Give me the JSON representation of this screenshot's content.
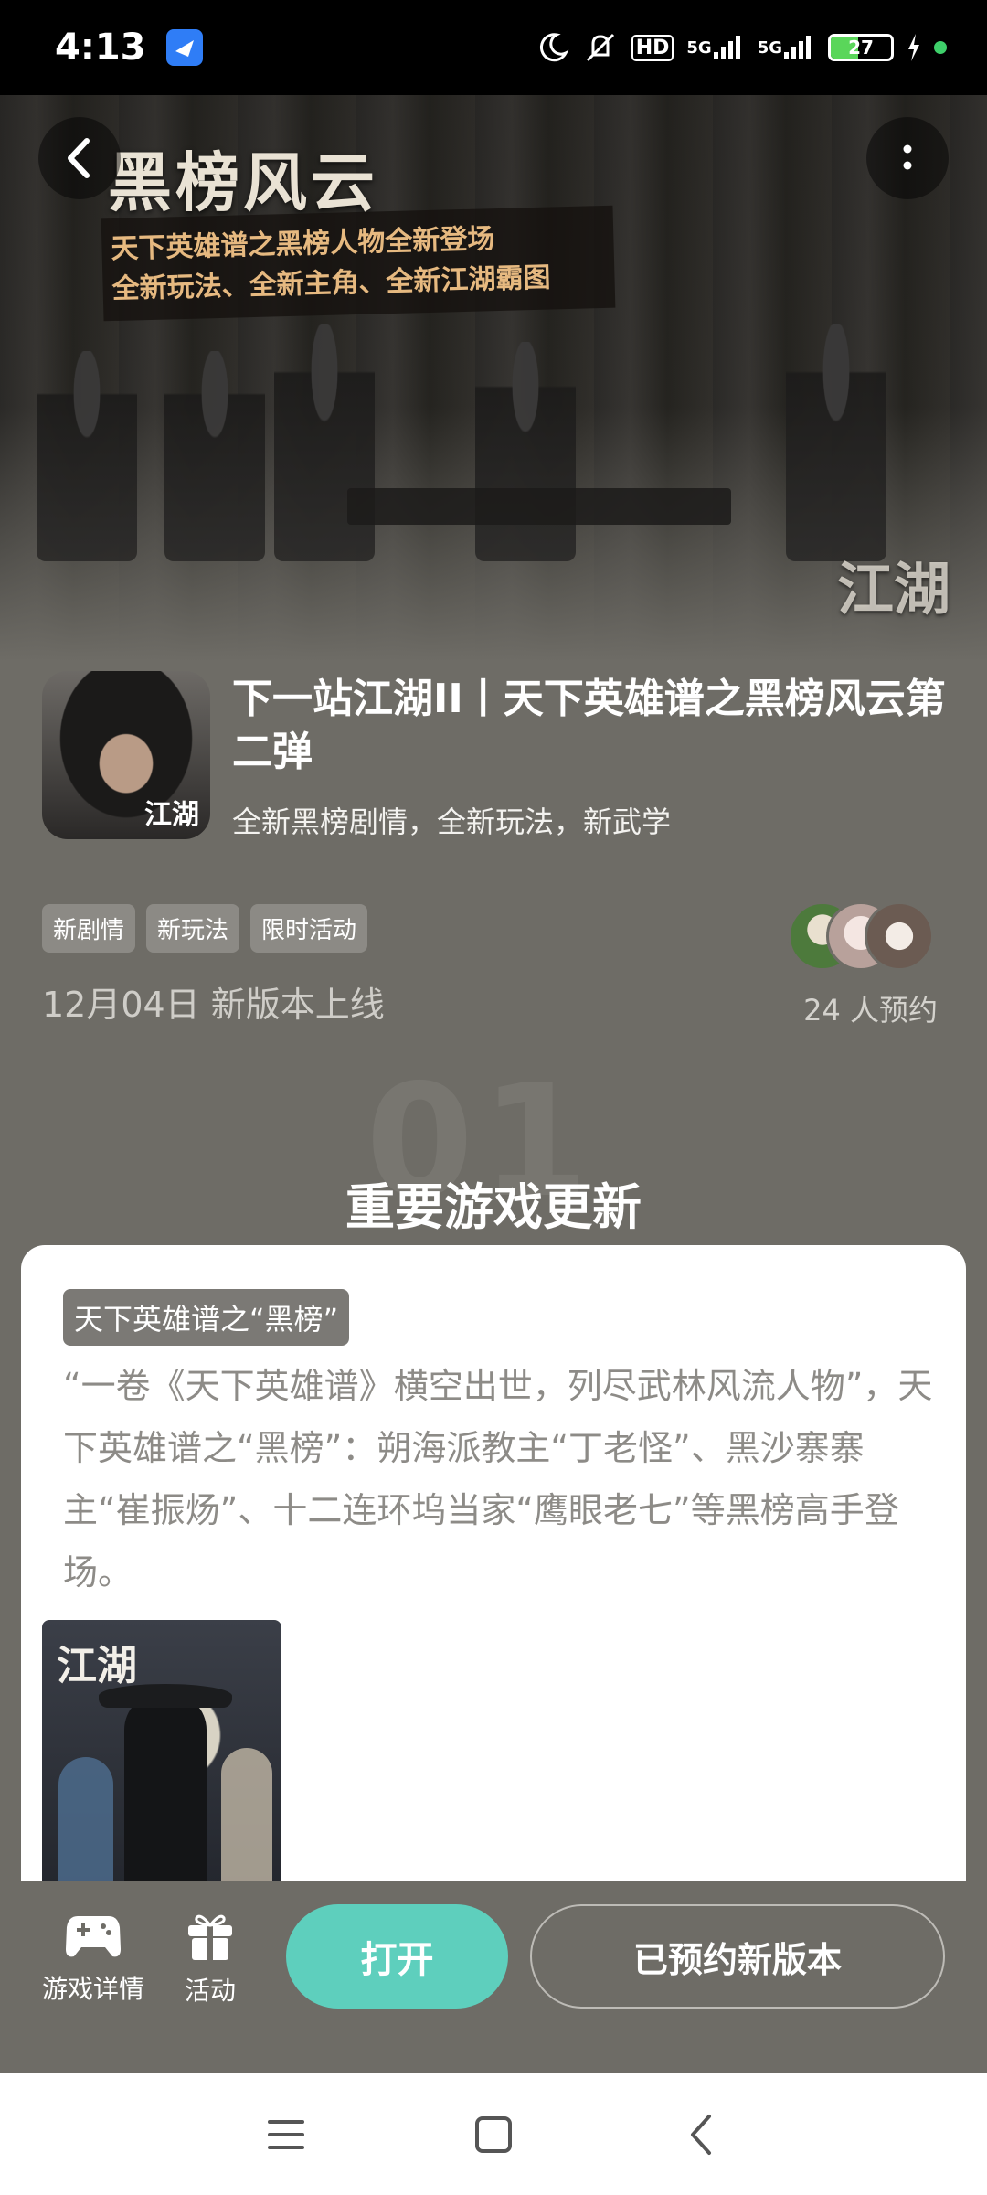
{
  "status_bar": {
    "time": "4:13",
    "battery": "27",
    "network_1": "5G",
    "network_2": "5G",
    "hd": "HD"
  },
  "banner": {
    "title": "黑榜风云",
    "subtitle_line1": "天下英雄谱之黑榜人物全新登场",
    "subtitle_line2": "全新玩法、全新主角、全新江湖霸图",
    "logo": "江湖"
  },
  "app": {
    "title": "下一站江湖II丨天下英雄谱之黑榜风云第二弹",
    "subtitle": "全新黑榜剧情，全新玩法，新武学",
    "icon_logo": "江湖",
    "tags": [
      "新剧情",
      "新玩法",
      "限时活动"
    ],
    "release": "12月04日 新版本上线",
    "reserve_count": "24 人预约"
  },
  "section": {
    "watermark": "01",
    "title": "重要游戏更新"
  },
  "card": {
    "tag": "天下英雄谱之“黑榜”",
    "text": "“一卷《天下英雄谱》横空出世，列尽武林风流人物”，天下英雄谱之“黑榜”：朔海派教主“丁老怪”、黑沙寨寨主“崔振炀”、十二连环坞当家“鹰眼老七”等黑榜高手登场。",
    "image_logo": "江湖"
  },
  "action_bar": {
    "tab_details": "游戏详情",
    "tab_activity": "活动",
    "open_label": "打开",
    "reserved_label": "已预约新版本"
  },
  "colors": {
    "background": "#6e6c66",
    "accent": "#5ecfbd",
    "card": "#ffffff"
  }
}
